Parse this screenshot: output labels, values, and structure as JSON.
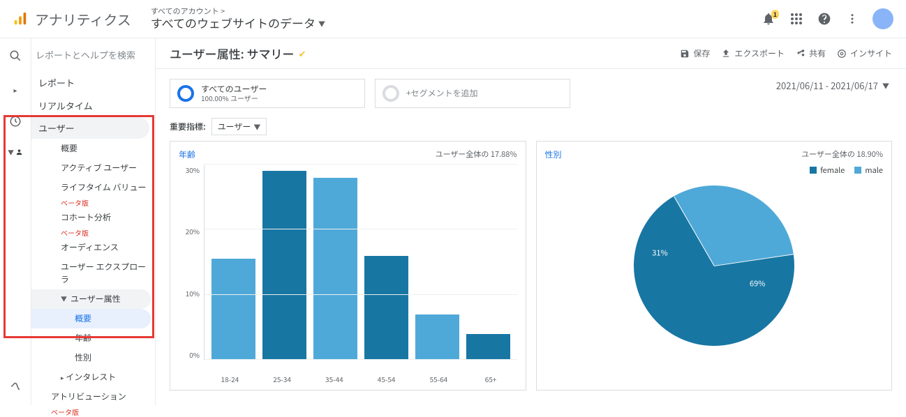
{
  "header": {
    "brand": "アナリティクス",
    "account_small": "すべてのアカウント >",
    "account_big": "すべてのウェブサイトのデータ",
    "notif_badge": "1"
  },
  "search": {
    "placeholder": "レポートとヘルプを検索"
  },
  "sidebar": {
    "report": "レポート",
    "realtime": "リアルタイム",
    "user": "ユーザー",
    "items": {
      "overview": "概要",
      "active": "アクティブ ユーザー",
      "ltv": "ライフタイム バリュー",
      "cohort": "コホート分析",
      "audience": "オーディエンス",
      "explorer": "ユーザー エクスプローラ",
      "demographics": "ユーザー属性",
      "demo_overview": "概要",
      "age": "年齢",
      "gender": "性別",
      "interest": "インタレスト"
    },
    "beta": "ベータ版",
    "attrib": "アトリビューション"
  },
  "toolbar": {
    "title": "ユーザー属性: サマリー",
    "save": "保存",
    "export": "エクスポート",
    "share": "共有",
    "insight": "インサイト"
  },
  "segments": {
    "all_users": "すべてのユーザー",
    "all_users_sub": "100.00% ユーザー",
    "add": "+セグメントを追加"
  },
  "date_range": "2021/06/11 - 2021/06/17",
  "metric": {
    "label": "重要指標:",
    "value": "ユーザー"
  },
  "age_card": {
    "title": "年齢",
    "sub": "ユーザー全体の 17.88%"
  },
  "gender_card": {
    "title": "性別",
    "sub": "ユーザー全体の 18.90%"
  },
  "legend": {
    "female": "female",
    "male": "male"
  },
  "chart_data": [
    {
      "type": "bar",
      "title": "年齢",
      "ylabel": "",
      "ylim": [
        0,
        30
      ],
      "yticks": [
        0,
        10,
        20,
        30
      ],
      "categories": [
        "18-24",
        "25-34",
        "35-44",
        "45-54",
        "55-64",
        "65+"
      ],
      "values": [
        15.5,
        29,
        28,
        16,
        7,
        4
      ],
      "colors": [
        "#4fa9d8",
        "#1876a3",
        "#4fa9d8",
        "#1876a3",
        "#4fa9d8",
        "#1876a3"
      ]
    },
    {
      "type": "pie",
      "title": "性別",
      "series": [
        {
          "name": "female",
          "value": 69,
          "label": "69%",
          "color": "#1876a3"
        },
        {
          "name": "male",
          "value": 31,
          "label": "31%",
          "color": "#4fa9d8"
        }
      ]
    }
  ]
}
